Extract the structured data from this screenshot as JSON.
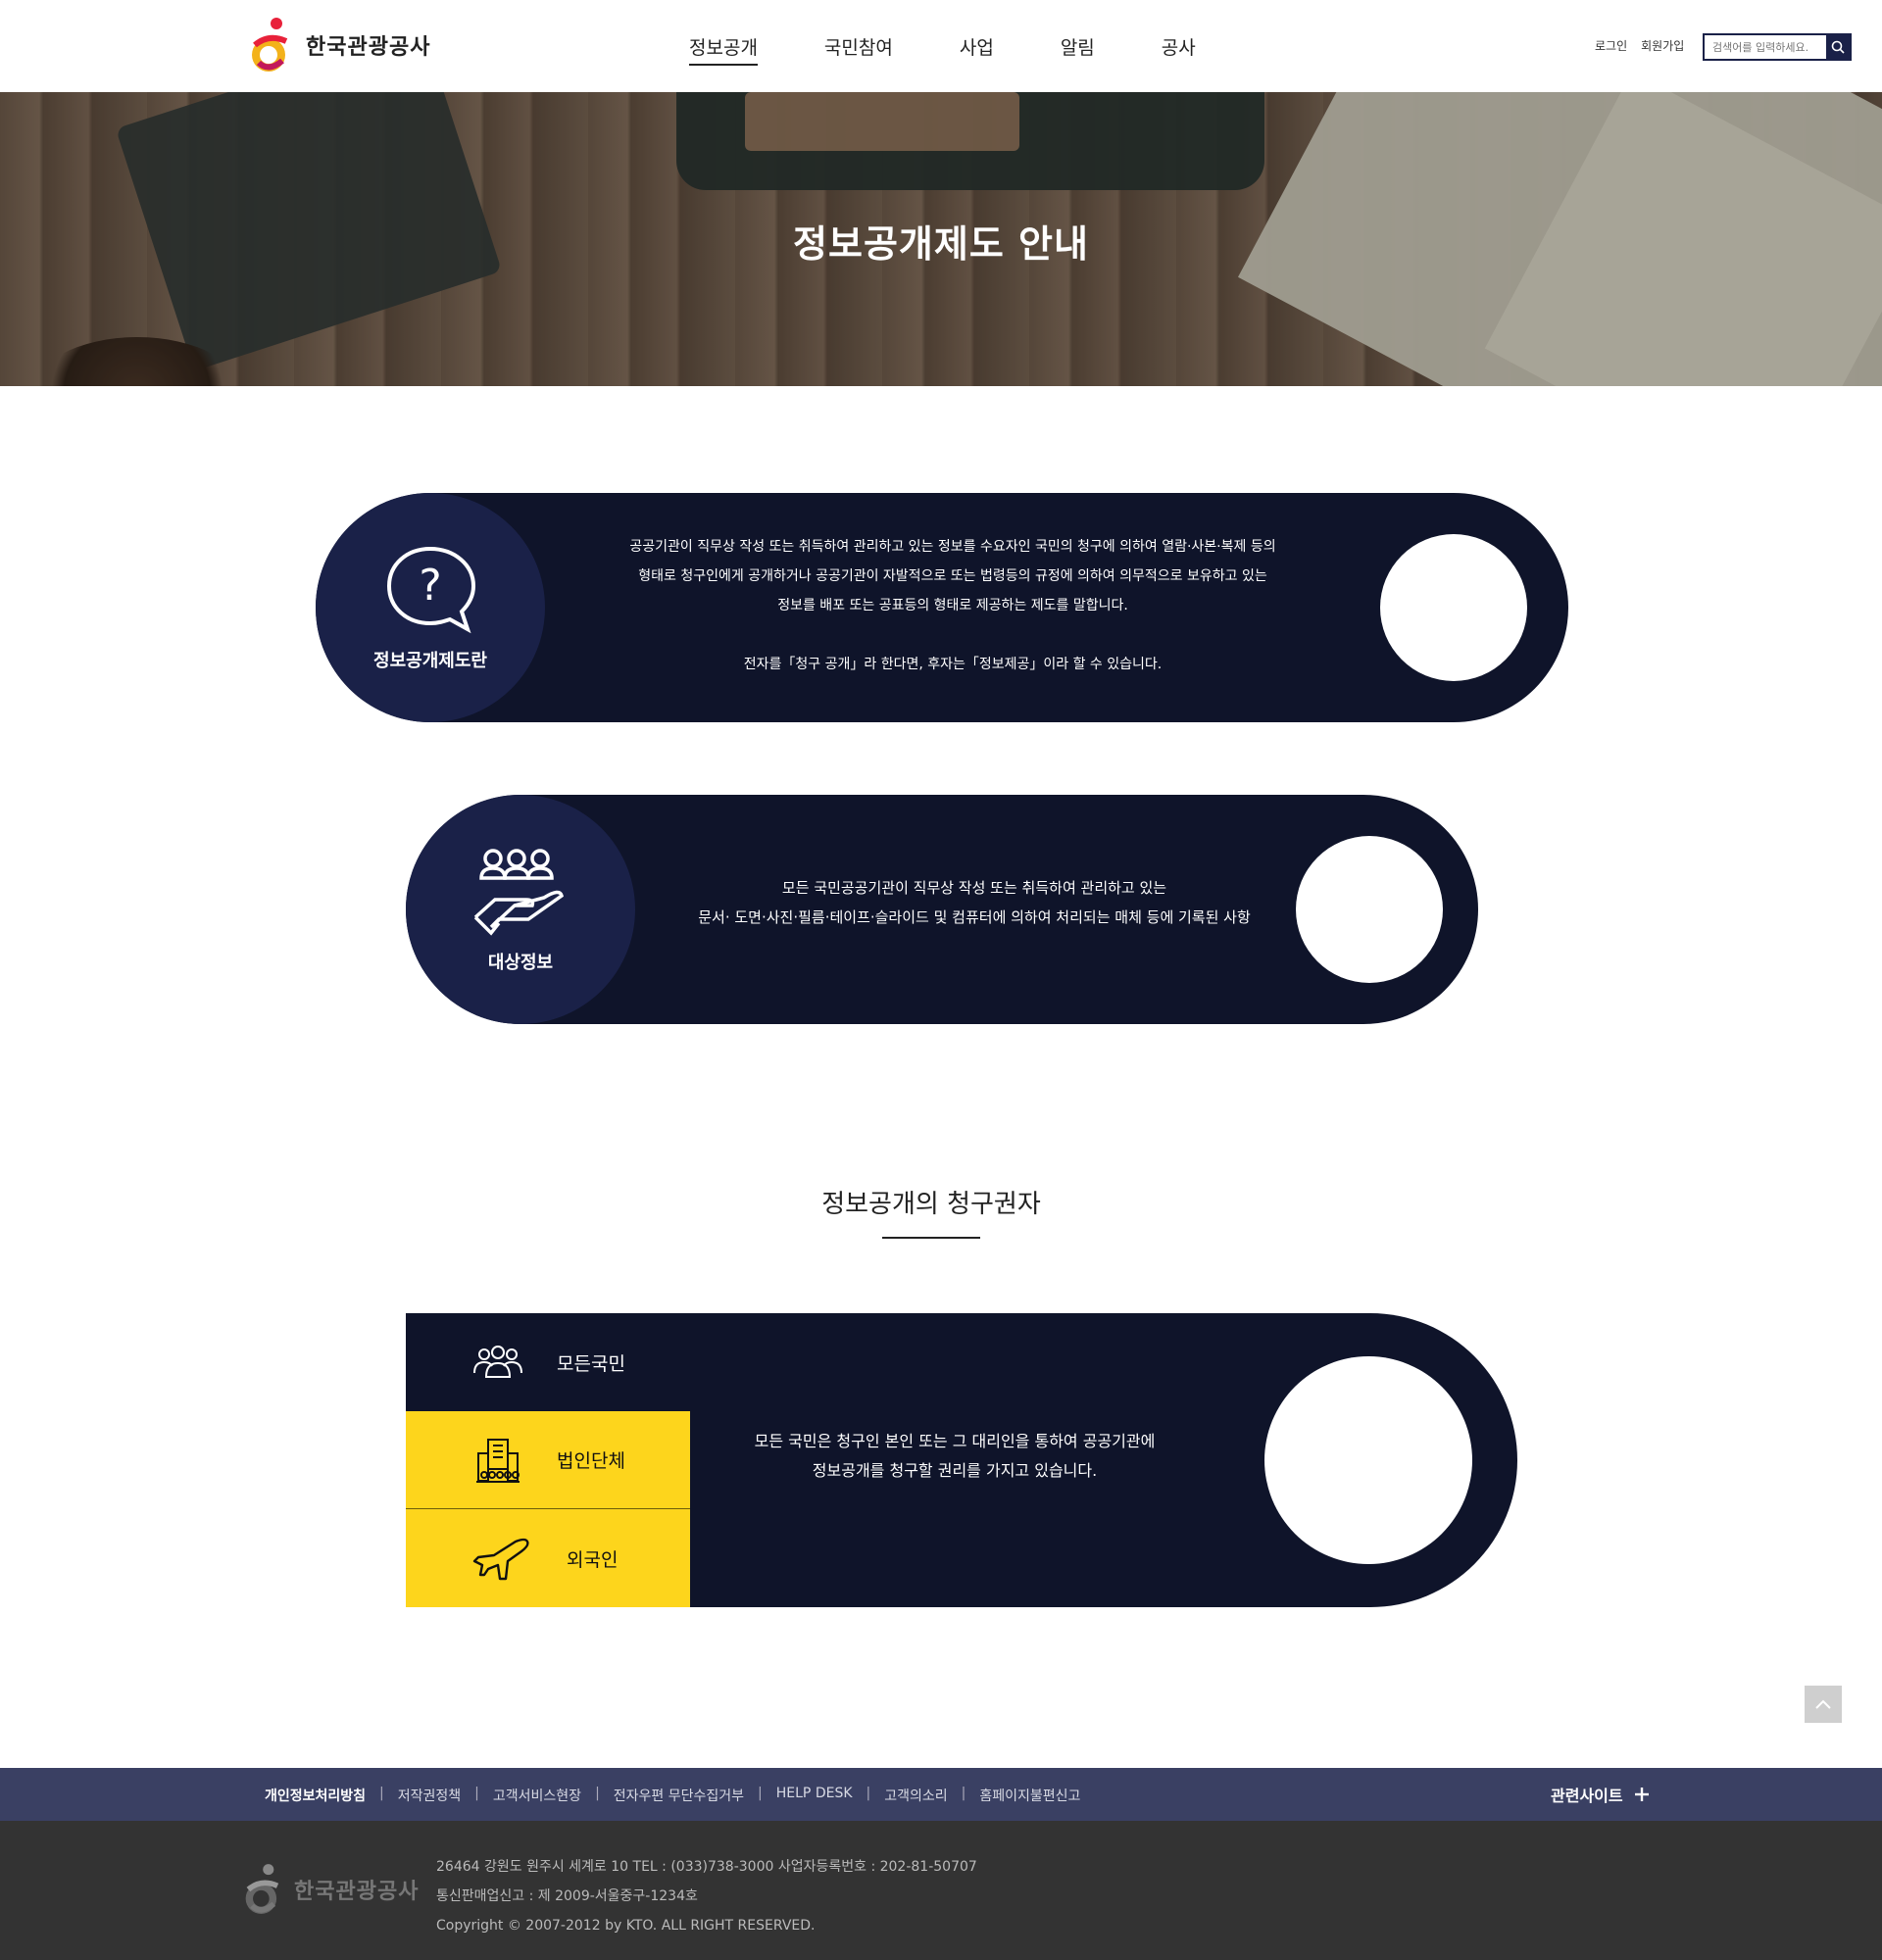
{
  "header": {
    "logo_text": "한국관광공사",
    "nav": [
      "정보공개",
      "국민참여",
      "사업",
      "알림",
      "공사"
    ],
    "util": {
      "login": "로그인",
      "join": "회원가입"
    },
    "search": {
      "placeholder": "검색어를 입력하세요."
    }
  },
  "hero": {
    "title": "정보공개제도 안내"
  },
  "intro": {
    "label": "정보공개제도란",
    "line1": "공공기관이 직무상 작성 또는 취득하여 관리하고 있는 정보를 수요자인 국민의 청구에 의하여 열람·사본·복제 등의",
    "line2": "형태로 청구인에게 공개하거나 공공기관이 자발적으로 또는 법령등의 규정에 의하여 의무적으로 보유하고 있는",
    "line3": "정보를 배포 또는 공표등의 형태로 제공하는 제도를 말합니다.",
    "line4": "전자를「청구 공개」라 한다면, 후자는「정보제공」이라 할 수 있습니다."
  },
  "target": {
    "label": "대상정보",
    "line1": "모든 국민공공기관이 직무상 작성 또는 취득하여 관리하고 있는",
    "line2": "문서· 도면·사진·필름·테이프·슬라이드 및 컴퓨터에 의하여 처리되는 매체 등에 기록된 사항"
  },
  "rights": {
    "title": "정보공개의 청구권자",
    "tabs": [
      "모든국민",
      "법인단체",
      "외국인"
    ],
    "desc1": "모든 국민은 청구인 본인 또는 그 대리인을 통하여 공공기관에",
    "desc2": "정보공개를 청구할 권리를 가지고 있습니다."
  },
  "footer": {
    "links": [
      "개인정보처리방침",
      "저작권정책",
      "고객서비스현장",
      "전자우편 무단수집거부",
      "HELP DESK",
      "고객의소리",
      "홈페이지불편신고"
    ],
    "related": "관련사이트",
    "logo_text": "한국관광공사",
    "address": "26464 강원도 원주시 세계로 10 TEL : (033)738-3000 사업자등록번호 : 202-81-50707",
    "mail_order": "통신판매업신고 : 제 2009-서울중구-1234호",
    "copyright": "Copyright © 2007-2012 by KTO. ALL RIGHT RESERVED."
  },
  "colors": {
    "navy": "#0f142a",
    "navy_light": "#1a2148",
    "yellow": "#fdd51c",
    "footer_nav": "#3a4063",
    "footer": "#333333"
  }
}
